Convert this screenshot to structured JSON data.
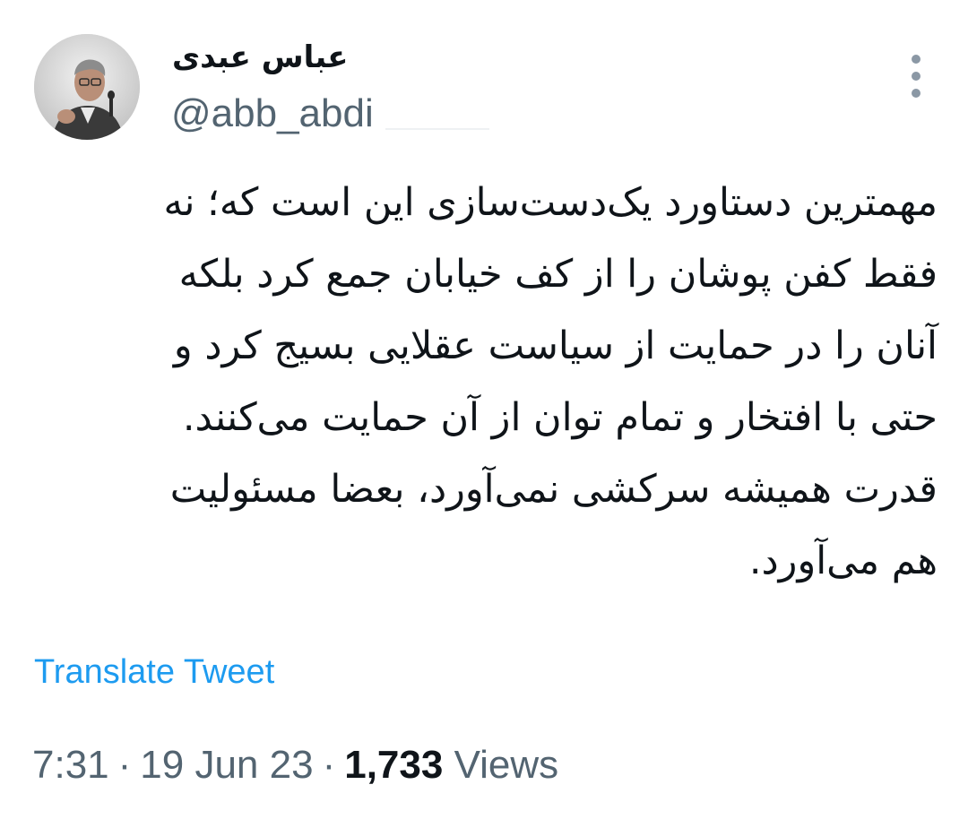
{
  "author": {
    "display_name": "عباس عبدی",
    "handle": "@abb_abdi"
  },
  "tweet": {
    "lines": [
      "مهمترین دستاورد یک‌دست‌سازی این است که؛ نه",
      "فقط کفن پوشان را از کف خیابان جمع کرد بلکه",
      "آنان را در حمایت از سیاست عقلایی بسیج کرد و",
      "حتی با افتخار و تمام توان از آن حمایت می‌کنند.",
      "قدرت همیشه سرکشی نمی‌آورد، بعضا مسئولیت",
      "هم می‌آورد."
    ],
    "translate_label": "Translate Tweet"
  },
  "meta": {
    "time": "7:31",
    "date": "19 Jun 23",
    "separator": "·",
    "views_count": "1,733",
    "views_label": "Views"
  },
  "icons": {
    "more": "more-vertical-icon",
    "avatar": "profile-avatar"
  },
  "colors": {
    "link": "#1d9bf0",
    "secondary_text": "#536471",
    "primary_text": "#0f1419"
  }
}
